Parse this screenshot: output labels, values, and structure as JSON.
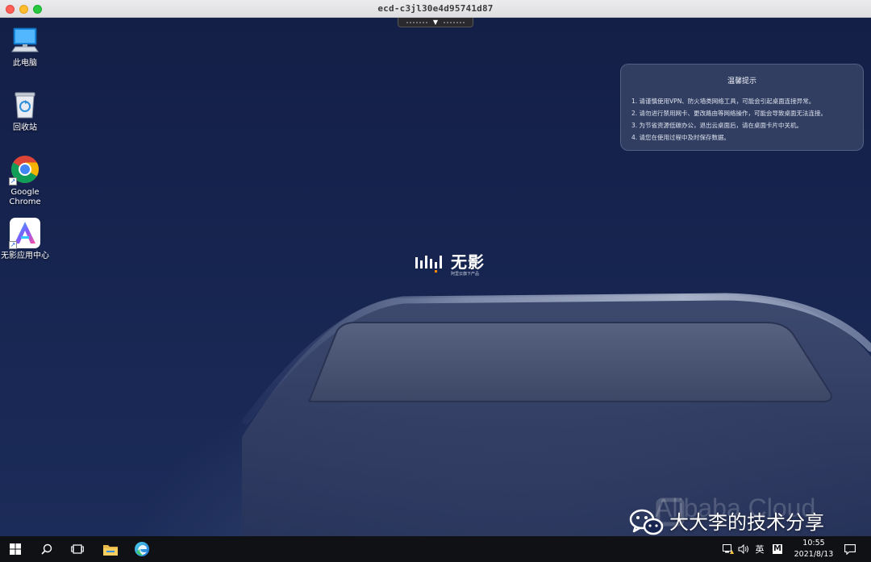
{
  "window": {
    "title": "ecd-c3jl30e4d95741d87"
  },
  "desktop_icons": [
    {
      "label": "此电脑",
      "icon": "computer-icon"
    },
    {
      "label": "回收站",
      "icon": "recycle-bin-icon"
    },
    {
      "label": "Google Chrome",
      "icon": "chrome-icon"
    },
    {
      "label": "无影应用中心",
      "icon": "wuying-app-center-icon"
    }
  ],
  "tip_card": {
    "title": "温馨提示",
    "items": [
      "1. 请谨慎使用VPN、防火墙类网络工具，可能会引起桌面连接异常。",
      "2. 请勿进行禁用网卡、更改路由等网络操作，可能会导致桌面无法连接。",
      "3. 为节省资源低碳办公，退出云桌面后，请在桌面卡片中关机。",
      "4. 请您在使用过程中及时保存数据。"
    ]
  },
  "logo": {
    "name": "无影",
    "subtitle": "阿里云旗下产品"
  },
  "wallpaper": {
    "brand": "Alibaba Cloud"
  },
  "watermark": {
    "text": "大大李的技术分享",
    "icon": "wechat-icon"
  },
  "taskbar": {
    "buttons": [
      "windows-start-icon",
      "search-icon",
      "task-view-icon",
      "file-explorer-icon",
      "edge-icon"
    ],
    "tray": {
      "ime": "英",
      "ime_mode": "M"
    },
    "clock": {
      "time": "10:55",
      "date": "2021/8/13"
    }
  },
  "colors": {
    "desktop_bg": "#16244f",
    "taskbar_bg": "#101114",
    "close": "#fe5f57",
    "minimize": "#febc2e",
    "maximize": "#28c840"
  }
}
